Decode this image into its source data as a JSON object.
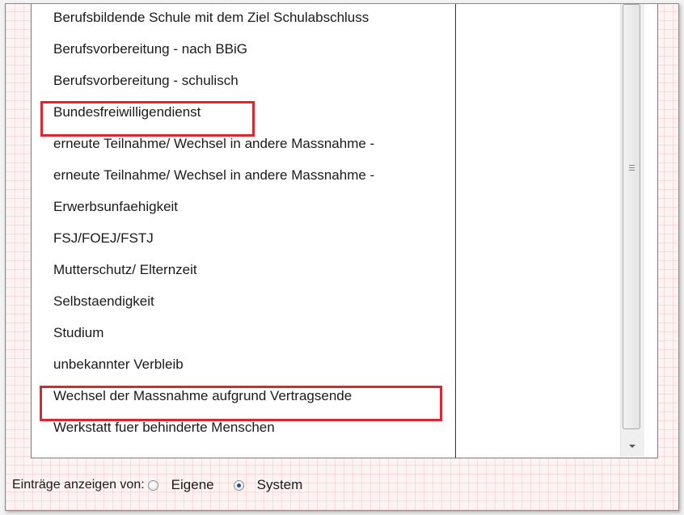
{
  "list": {
    "items": [
      "Berufsbildende Schule mit dem Ziel Schulabschluss",
      "Berufsvorbereitung - nach BBiG",
      "Berufsvorbereitung - schulisch",
      "Bundesfreiwilligendienst",
      "erneute Teilnahme/ Wechsel in andere Massnahme - ",
      "erneute Teilnahme/ Wechsel in andere Massnahme - ",
      "Erwerbsunfaehigkeit",
      "FSJ/FOEJ/FSTJ",
      "Mutterschutz/ Elternzeit",
      "Selbstaendigkeit",
      "Studium",
      "unbekannter Verbleib",
      "Wechsel der Massnahme aufgrund Vertragsende",
      "Werkstatt fuer behinderte Menschen"
    ],
    "highlighted": [
      "Bundesfreiwilligendienst",
      "Wechsel der Massnahme aufgrund Vertragsende"
    ]
  },
  "footer": {
    "label": "Einträge anzeigen von:",
    "option_own": "Eigene",
    "option_system": "System",
    "selected": "System"
  },
  "colors": {
    "highlight": "#e0262c",
    "radio_selected": "#1f4f9a"
  }
}
